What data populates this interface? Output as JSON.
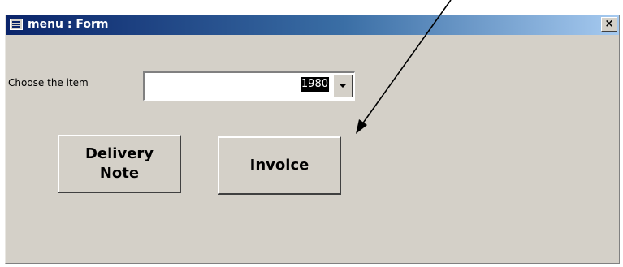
{
  "window": {
    "title": "menu : Form",
    "icon": "form-icon",
    "close_label": "×",
    "close_icon": "close-icon"
  },
  "form": {
    "item_label": "Choose the item",
    "item_value": "1980",
    "dropdown_icon": "chevron-down-icon",
    "buttons": {
      "delivery_note": "Delivery\nNote",
      "invoice": "Invoice"
    }
  },
  "annotation": {
    "arrow_color": "#000000"
  },
  "colors": {
    "face": "#d4d0c8",
    "title_start": "#0a246a",
    "title_end": "#a6caf0",
    "selection": "#000000"
  }
}
